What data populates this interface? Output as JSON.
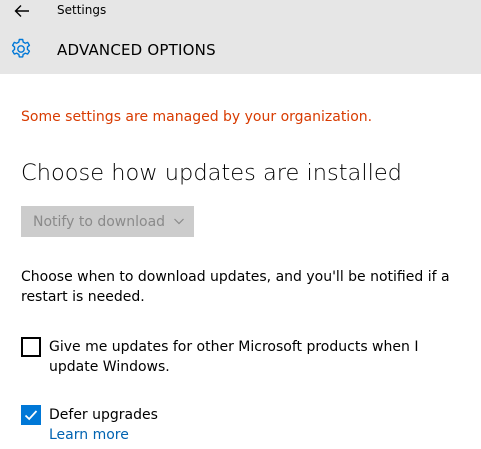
{
  "window": {
    "title": "Settings",
    "back_icon": "back-arrow-icon"
  },
  "page": {
    "title": "ADVANCED OPTIONS",
    "icon": "gear-icon"
  },
  "notice": {
    "managed_text": "Some settings are managed by your organization.",
    "color": "#d83b01"
  },
  "install_section": {
    "heading": "Choose how updates are installed",
    "dropdown": {
      "selected": "Notify to download",
      "disabled": true
    },
    "description": "Choose when to download updates, and you'll be notified if a restart is needed."
  },
  "options": [
    {
      "label": "Give me updates for other Microsoft products when I update Windows.",
      "checked": false
    },
    {
      "label": "Defer upgrades",
      "checked": true,
      "link": "Learn more"
    }
  ],
  "colors": {
    "accent": "#0078d7",
    "header_bg": "#e6e6e6",
    "link": "#0063b1"
  }
}
